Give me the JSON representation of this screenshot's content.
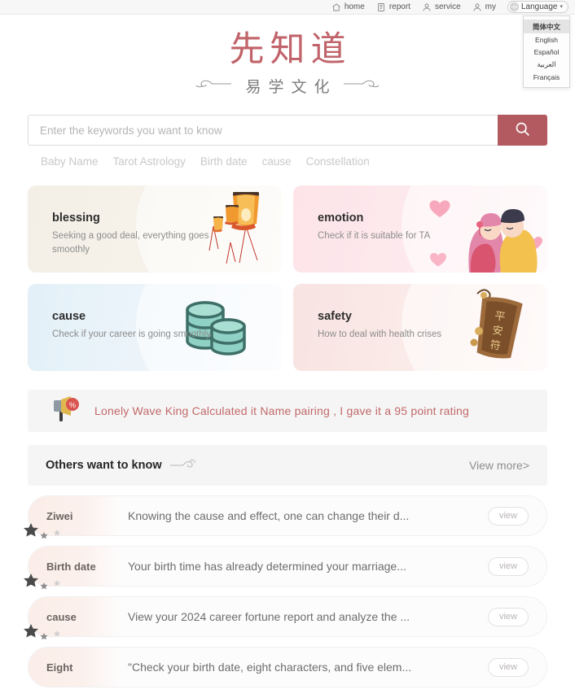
{
  "topnav": {
    "items": [
      {
        "label": "home",
        "icon": "home-icon"
      },
      {
        "label": "report",
        "icon": "report-icon"
      },
      {
        "label": "service",
        "icon": "service-person-icon"
      },
      {
        "label": "my",
        "icon": "user-icon"
      }
    ],
    "language_button": "Language",
    "caret": "▾"
  },
  "language_menu": {
    "options": [
      {
        "label": "简体中文",
        "selected": true
      },
      {
        "label": "English",
        "selected": false
      },
      {
        "label": "Español",
        "selected": false
      },
      {
        "label": "العربية",
        "selected": false
      },
      {
        "label": "Français",
        "selected": false
      }
    ]
  },
  "logo": {
    "main": "先知道",
    "sub": "易学文化",
    "color": "#c1636a"
  },
  "search": {
    "placeholder": "Enter the keywords you want to know",
    "value": "",
    "button_icon": "search-icon",
    "button_color": "#b35a60",
    "tags": [
      "Baby Name",
      "Tarot Astrology",
      "Birth date",
      "cause",
      "Constellation"
    ]
  },
  "cards": [
    {
      "title": "blessing",
      "desc": "Seeking a good deal, everything goes smoothly",
      "art": "lantern-illustration",
      "bg": "#f3efe6"
    },
    {
      "title": "emotion",
      "desc": "Check if it is suitable for TA",
      "art": "couple-hearts-illustration",
      "bg": "#fde4e9"
    },
    {
      "title": "cause",
      "desc": "Check if your career is going smoothly",
      "art": "coin-stacks-illustration",
      "bg": "#e3f0f8"
    },
    {
      "title": "safety",
      "desc": "How to deal with health crises",
      "art": "amulet-talisman-illustration",
      "bg": "#f8e4e2"
    }
  ],
  "announcement": {
    "icon": "megaphone-percent-icon",
    "text": "Lonely Wave King Calculated it  Name pairing ,  I gave it a 95 point rating",
    "text_color": "#c0696a"
  },
  "section": {
    "title": "Others want to know",
    "decoration": "cloud-icon",
    "view_more": "View more>"
  },
  "list": {
    "view_button_label": "view",
    "rows": [
      {
        "label": "Ziwei",
        "text": "Knowing the cause and effect, one can change their d..."
      },
      {
        "label": "Birth date",
        "text": "Your birth time has already determined your marriage..."
      },
      {
        "label": "cause",
        "text": "View your 2024 career fortune report and analyze the ..."
      },
      {
        "label": "Eight",
        "text": "\"Check your birth date, eight characters, and five elem..."
      }
    ]
  }
}
